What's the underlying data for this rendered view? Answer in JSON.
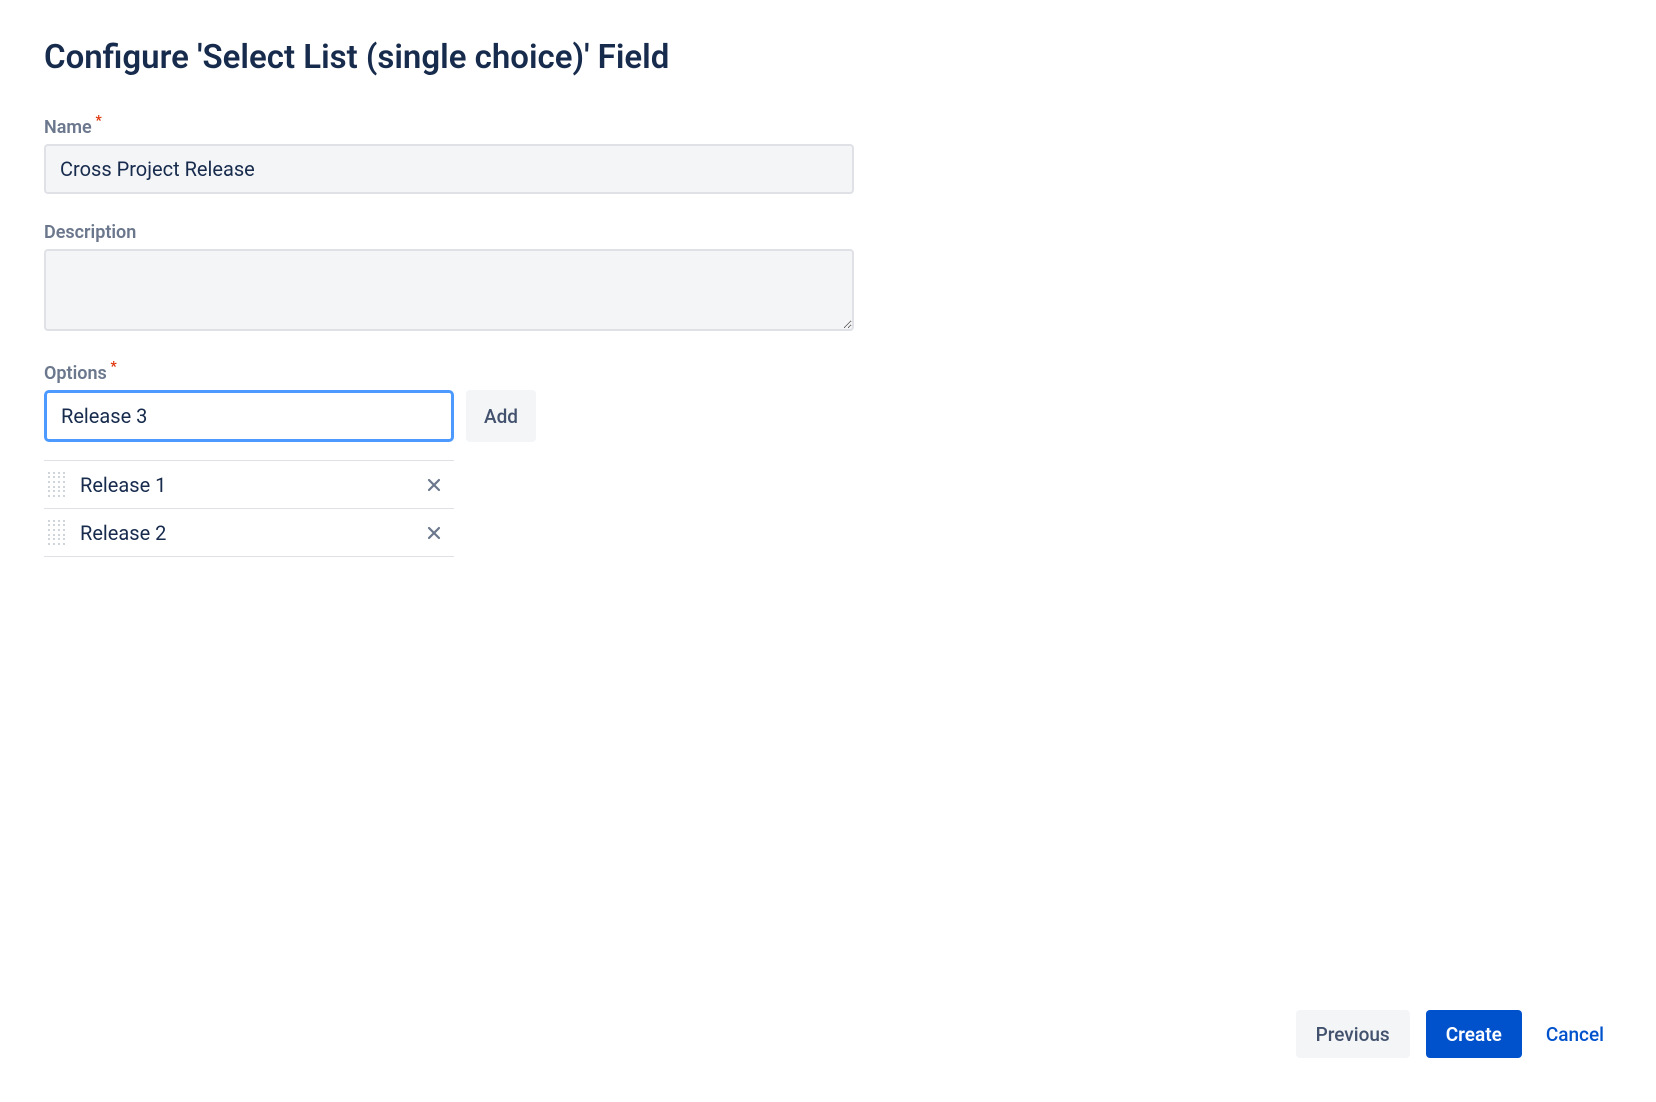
{
  "page": {
    "title": "Configure 'Select List (single choice)' Field"
  },
  "form": {
    "name": {
      "label": "Name",
      "value": "Cross Project Release"
    },
    "description": {
      "label": "Description",
      "value": ""
    },
    "options": {
      "label": "Options",
      "entry_value": "Release 3",
      "add_label": "Add",
      "items": [
        {
          "label": "Release 1"
        },
        {
          "label": "Release 2"
        }
      ]
    }
  },
  "footer": {
    "previous": "Previous",
    "create": "Create",
    "cancel": "Cancel"
  }
}
